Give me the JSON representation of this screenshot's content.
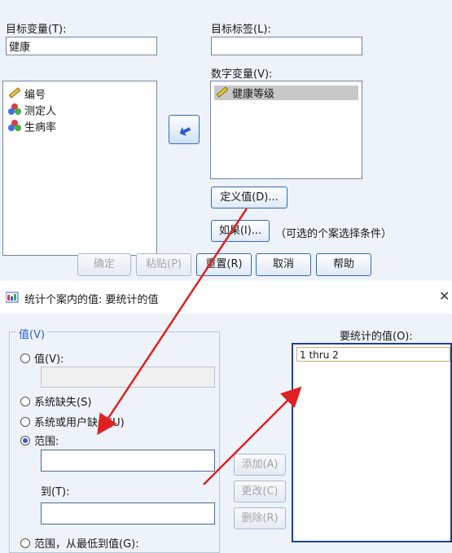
{
  "top_dialog": {
    "target_var_label": "目标变量(T):",
    "target_var_value": "健康",
    "target_label_label": "目标标签(L):",
    "target_label_value": "",
    "source_vars": [
      "编号",
      "测定人",
      "生病率"
    ],
    "numeric_vars_label": "数字变量(V):",
    "numeric_vars": [
      "健康等级"
    ],
    "define_values_button": "定义值(D)...",
    "if_button": "如果(I)...",
    "if_hint": "（可选的个案选择条件）",
    "buttons": {
      "ok": "确定",
      "paste": "粘贴(P)",
      "reset": "重置(R)",
      "cancel": "取消",
      "help": "帮助"
    }
  },
  "sub_dialog": {
    "title": "统计个案内的值: 要统计的值",
    "value_group": "值(V)",
    "radio_value": "值(V):",
    "radio_sysmis": "系统缺失(S)",
    "radio_sys_or_user": "系统或用户缺失(U)",
    "radio_range": "范围:",
    "to_label": "到(T):",
    "radio_range_lowest": "范围，从最低到值(G):",
    "values_to_count_label": "要统计的值(O):",
    "values_to_count": [
      "1 thru 2"
    ],
    "btn_add": "添加(A)",
    "btn_change": "更改(C)",
    "btn_remove": "删除(R)"
  },
  "colors": {
    "arrow": "#e02020",
    "accent": "#2a5bd7"
  }
}
